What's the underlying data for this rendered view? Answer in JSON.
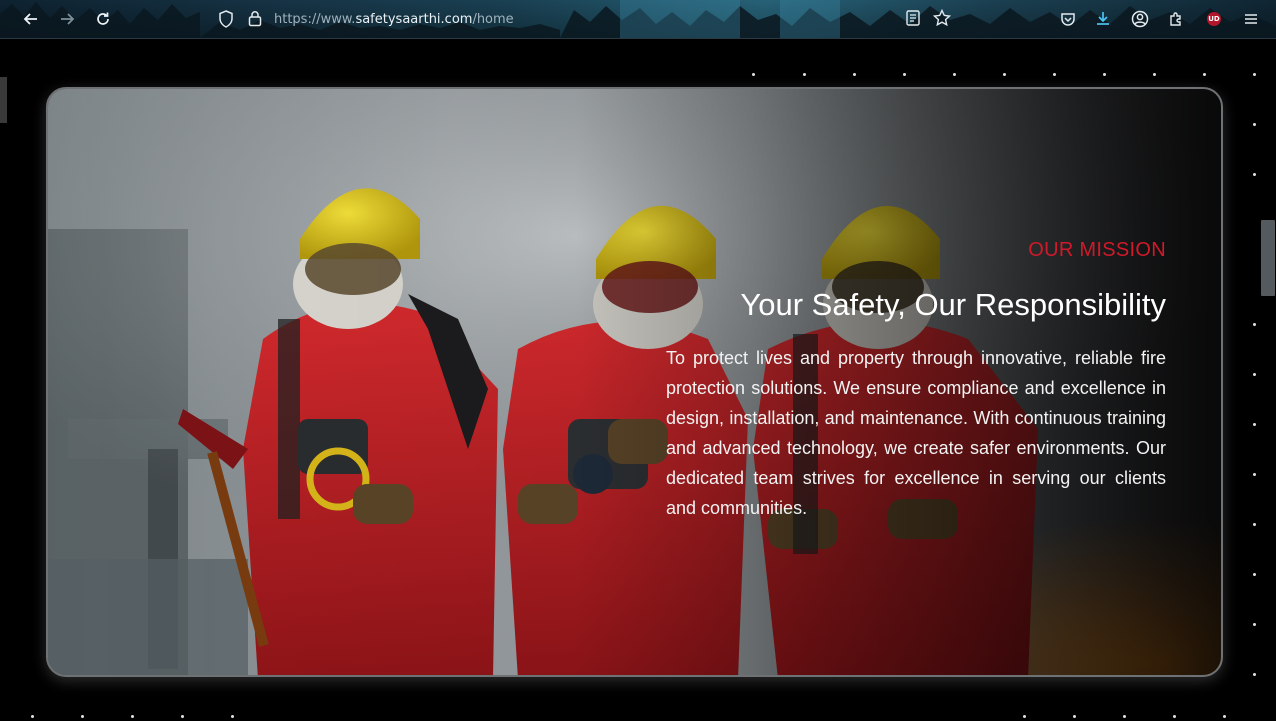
{
  "browser": {
    "url_prefix": "https://www.",
    "url_host": "safetysaarthi.com",
    "url_path": "/home",
    "extension_badge": "UD",
    "icons": [
      "back-arrow-icon",
      "forward-arrow-icon",
      "reload-icon",
      "shield-icon",
      "lock-icon",
      "reader-view-icon",
      "star-icon",
      "pocket-icon",
      "download-icon",
      "account-icon",
      "extensions-icon",
      "ublock-icon",
      "menu-icon"
    ]
  },
  "hero": {
    "eyebrow": "OUR MISSION",
    "headline": "Your Safety, Our Responsibility",
    "body": "To protect lives and property through innovative, reliable fire protection solutions. We ensure compliance and excellence in design, installation, and maintenance. With continuous training and advanced technology, we create safer environments. Our dedicated team strives for excellence in serving our clients and communities.",
    "image_alt": "Three firefighters in red suits and yellow helmets"
  },
  "colors": {
    "accent_red": "#d0192b",
    "text_white": "#ffffff",
    "page_bg": "#000000"
  }
}
